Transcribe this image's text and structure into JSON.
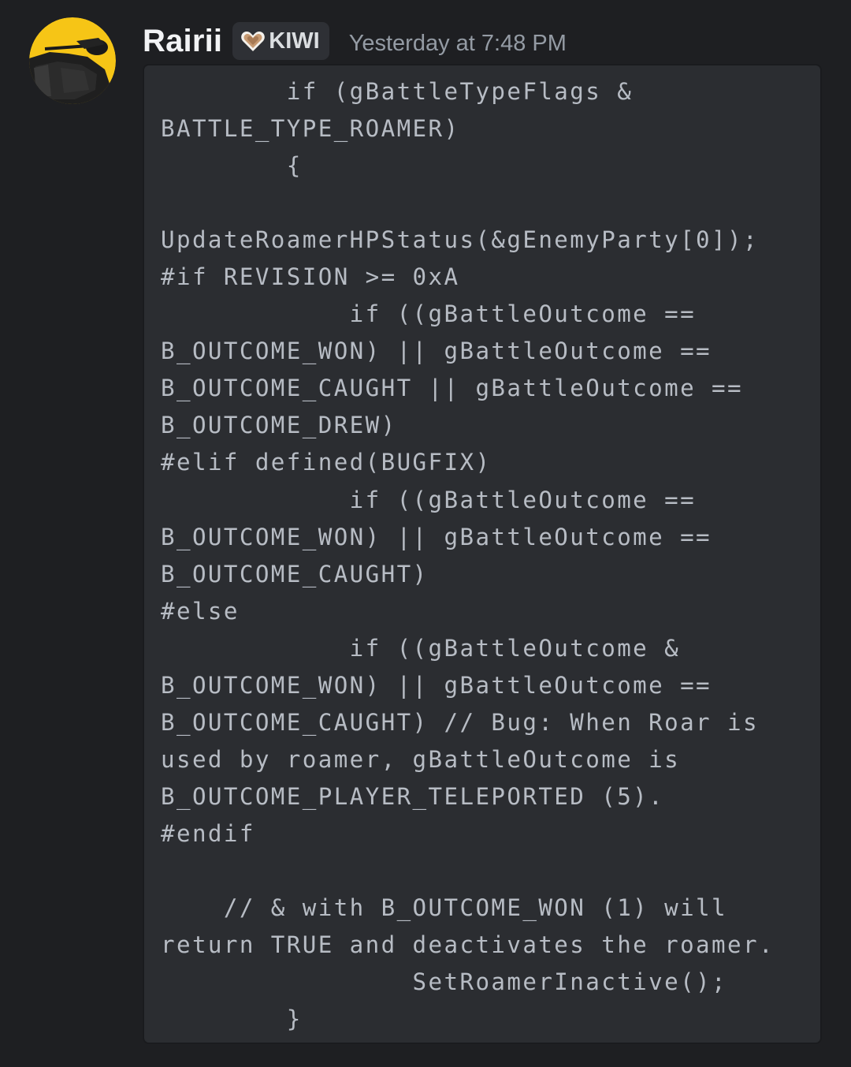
{
  "message": {
    "author": {
      "username": "Rairii",
      "tag_icon": "heart-icon",
      "tag_label": "KIWI"
    },
    "timestamp": "Yesterday at 7:48 PM",
    "code_lines": [
      "        if (gBattleTypeFlags &",
      "BATTLE_TYPE_ROAMER)",
      "        {",
      "",
      "UpdateRoamerHPStatus(&gEnemyParty[0]);",
      "#if REVISION >= 0xA",
      "            if ((gBattleOutcome ==",
      "B_OUTCOME_WON) || gBattleOutcome ==",
      "B_OUTCOME_CAUGHT || gBattleOutcome ==",
      "B_OUTCOME_DREW)",
      "#elif defined(BUGFIX)",
      "            if ((gBattleOutcome ==",
      "B_OUTCOME_WON) || gBattleOutcome ==",
      "B_OUTCOME_CAUGHT)",
      "#else",
      "            if ((gBattleOutcome &",
      "B_OUTCOME_WON) || gBattleOutcome ==",
      "B_OUTCOME_CAUGHT) // Bug: When Roar is",
      "used by roamer, gBattleOutcome is",
      "B_OUTCOME_PLAYER_TELEPORTED (5).",
      "#endif",
      "",
      "    // & with B_OUTCOME_WON (1) will",
      "return TRUE and deactivates the roamer.",
      "                SetRoamerInactive();",
      "        }"
    ]
  },
  "colors": {
    "background": "#1e1f22",
    "code_background": "#2b2d31",
    "username": "#f2f3f5",
    "timestamp": "#949ba4",
    "code_text": "#b7bcc4",
    "avatar_accent": "#f6c516"
  }
}
